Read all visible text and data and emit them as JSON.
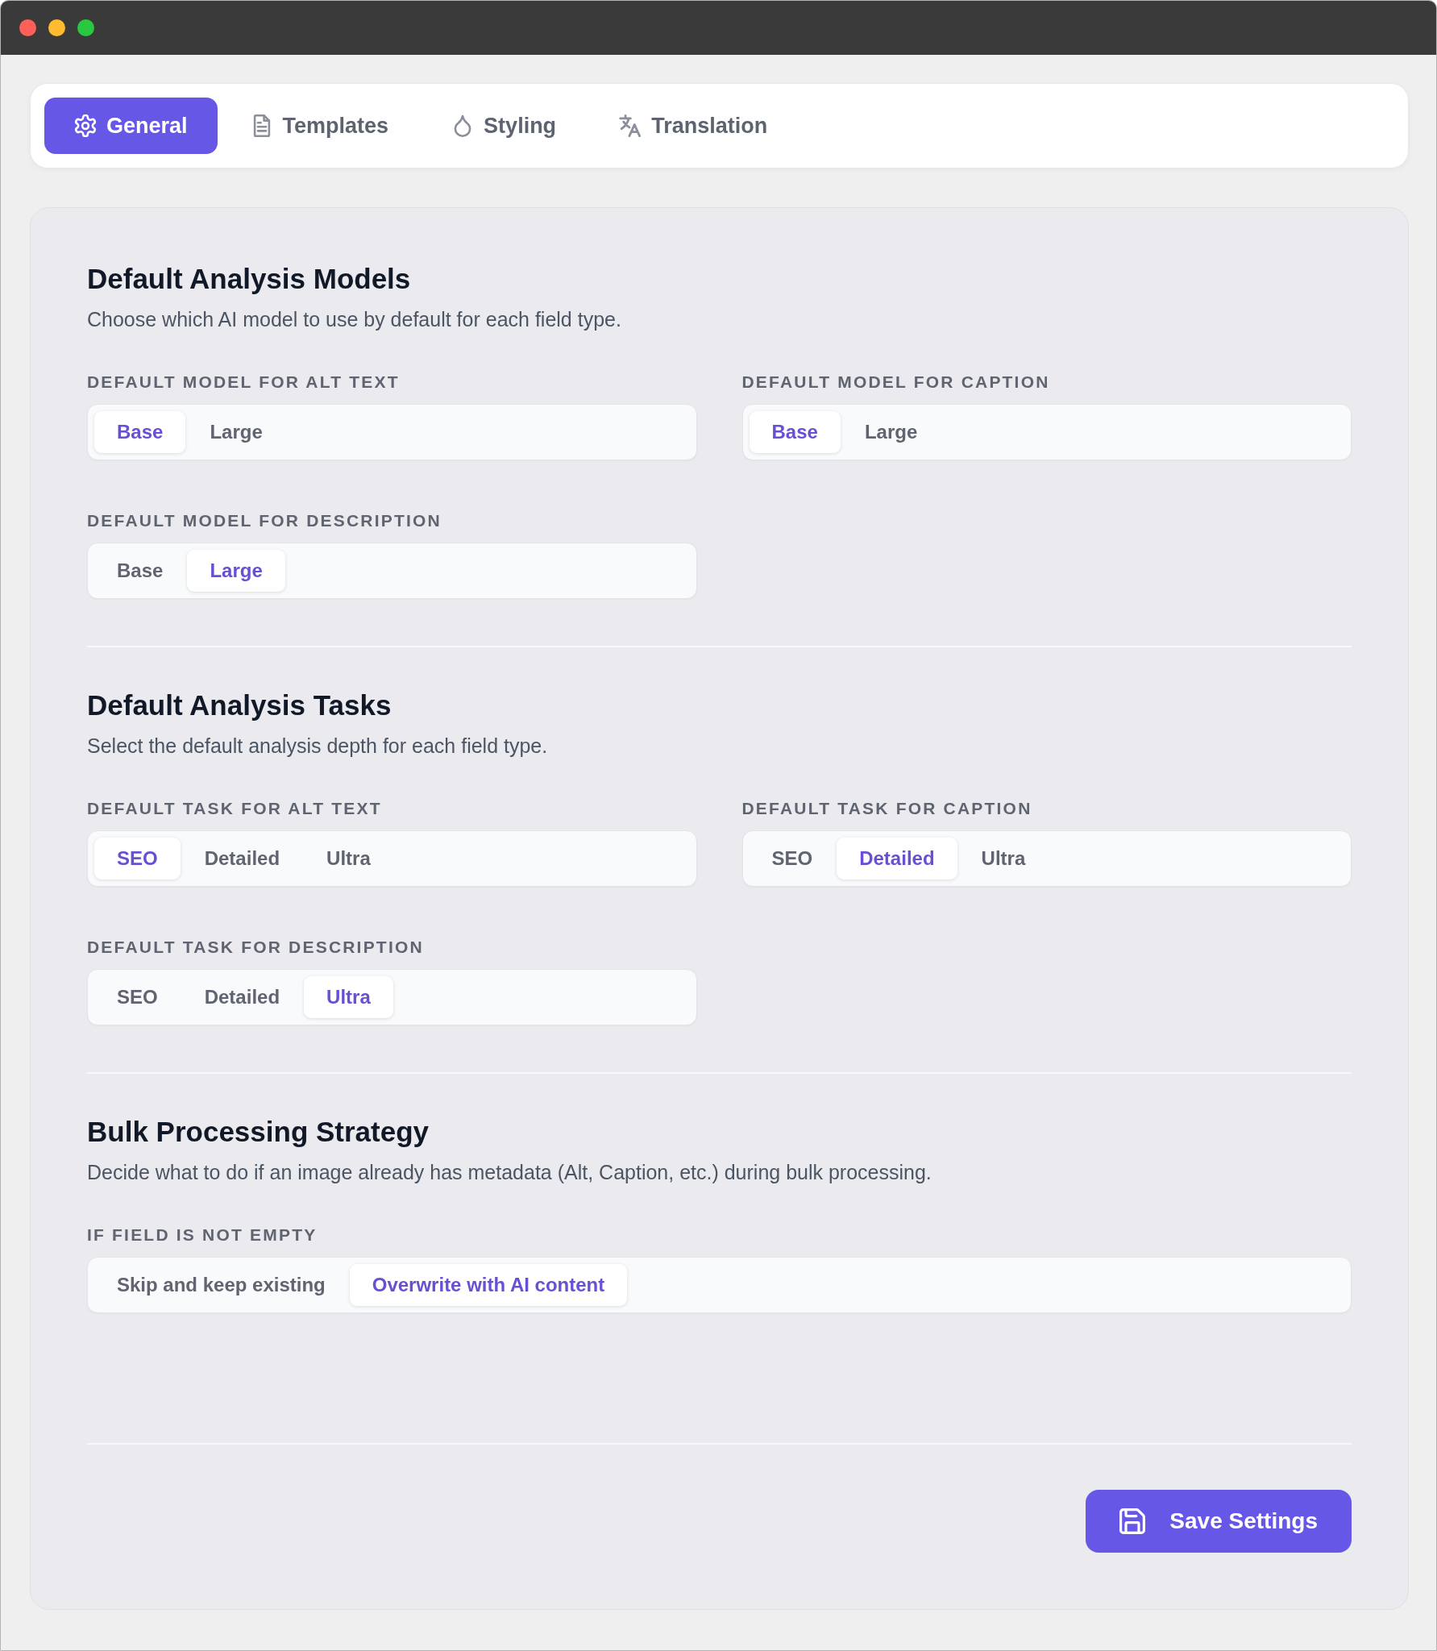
{
  "tabs": [
    {
      "label": "General",
      "selected": true
    },
    {
      "label": "Templates",
      "selected": false
    },
    {
      "label": "Styling",
      "selected": false
    },
    {
      "label": "Translation",
      "selected": false
    }
  ],
  "sections": [
    {
      "title": "Default Analysis Models",
      "description": "Choose which AI model to use by default for each field type.",
      "fields": [
        {
          "label": "DEFAULT MODEL FOR ALT TEXT",
          "options": [
            {
              "label": "Base",
              "selected": true
            },
            {
              "label": "Large",
              "selected": false
            }
          ]
        },
        {
          "label": "DEFAULT MODEL FOR CAPTION",
          "options": [
            {
              "label": "Base",
              "selected": true
            },
            {
              "label": "Large",
              "selected": false
            }
          ]
        },
        {
          "label": "DEFAULT MODEL FOR DESCRIPTION",
          "options": [
            {
              "label": "Base",
              "selected": false
            },
            {
              "label": "Large",
              "selected": true
            }
          ]
        }
      ]
    },
    {
      "title": "Default Analysis Tasks",
      "description": "Select the default analysis depth for each field type.",
      "fields": [
        {
          "label": "DEFAULT TASK FOR ALT TEXT",
          "options": [
            {
              "label": "SEO",
              "selected": true
            },
            {
              "label": "Detailed",
              "selected": false
            },
            {
              "label": "Ultra",
              "selected": false
            }
          ]
        },
        {
          "label": "DEFAULT TASK FOR CAPTION",
          "options": [
            {
              "label": "SEO",
              "selected": false
            },
            {
              "label": "Detailed",
              "selected": true
            },
            {
              "label": "Ultra",
              "selected": false
            }
          ]
        },
        {
          "label": "DEFAULT TASK FOR DESCRIPTION",
          "options": [
            {
              "label": "SEO",
              "selected": false
            },
            {
              "label": "Detailed",
              "selected": false
            },
            {
              "label": "Ultra",
              "selected": true
            }
          ]
        }
      ]
    },
    {
      "title": "Bulk Processing Strategy",
      "description": "Decide what to do if an image already has metadata (Alt, Caption, etc.) during bulk processing.",
      "fields": [
        {
          "label": "IF FIELD IS NOT EMPTY",
          "options": [
            {
              "label": "Skip and keep existing",
              "selected": false
            },
            {
              "label": "Overwrite with AI content",
              "selected": true
            }
          ]
        }
      ]
    }
  ],
  "save_button": {
    "label": "Save Settings"
  }
}
